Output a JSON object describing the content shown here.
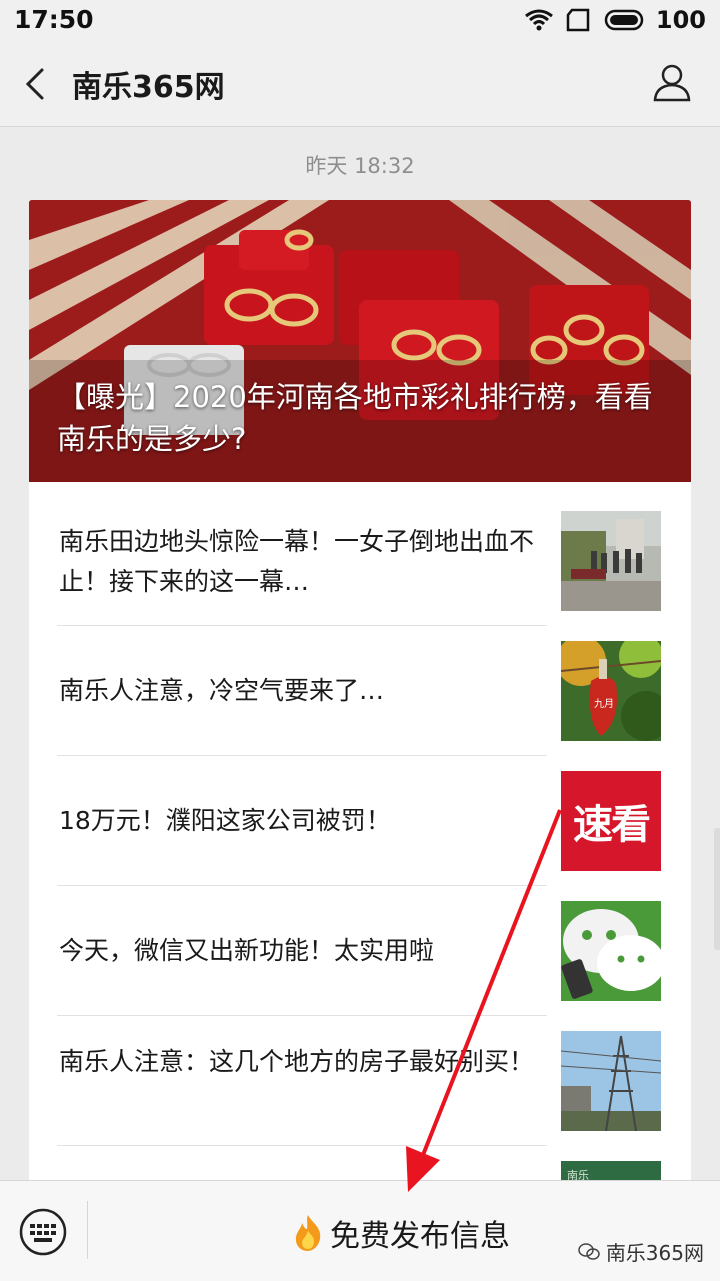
{
  "status_bar": {
    "time": "17:50",
    "battery": "100"
  },
  "nav": {
    "title": "南乐365网"
  },
  "timestamp": "昨天 18:32",
  "hero": {
    "title": "【曝光】2020年河南各地市彩礼排行榜，看看南乐的是多少?"
  },
  "articles": [
    {
      "title": "南乐田边地头惊险一幕！一女子倒地出血不止！接下来的这一幕…"
    },
    {
      "title": "南乐人注意，冷空气要来了…"
    },
    {
      "title": "18万元！濮阳这家公司被罚！",
      "thumb_text": "速看"
    },
    {
      "title": "今天，微信又出新功能！太实用啦"
    },
    {
      "title": "南乐人注意：这几个地方的房子最好别买！"
    }
  ],
  "thumb_labels": {
    "month_tag": "九月",
    "partial_thumb": "南乐"
  },
  "bottom_bar": {
    "menu_label": "免费发布信息"
  },
  "watermark": {
    "text": "南乐365网"
  },
  "icons": [
    "back-arrow-icon",
    "profile-icon",
    "wifi-icon",
    "sim-icon",
    "battery-icon",
    "keyboard-icon",
    "fire-icon",
    "wechat-icon"
  ],
  "colors": {
    "accent_red": "#d6162b",
    "annotation_arrow": "#e8141f"
  }
}
